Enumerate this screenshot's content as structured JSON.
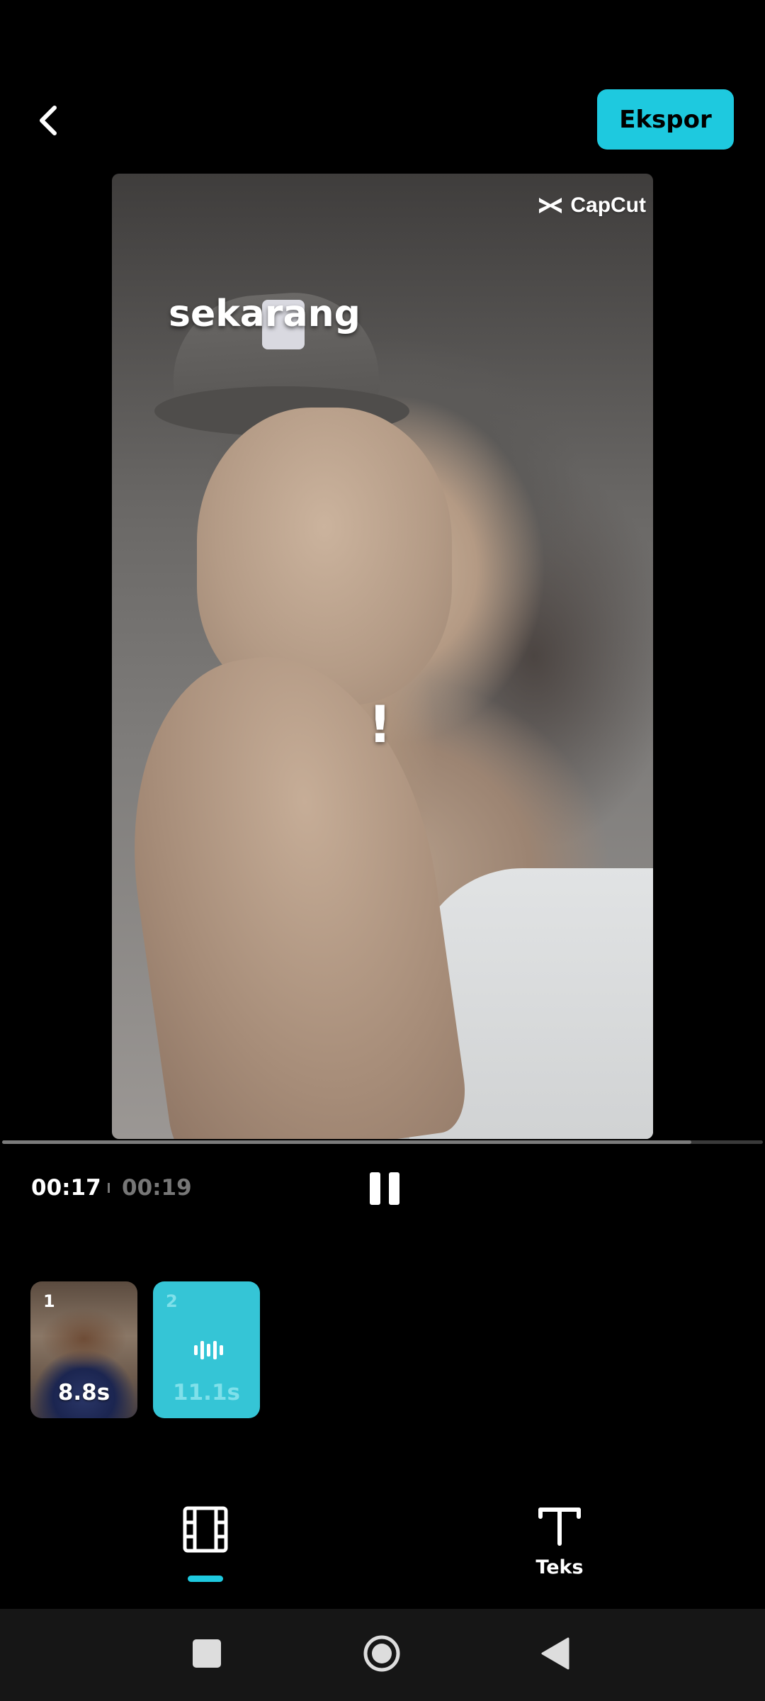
{
  "header": {
    "back_icon": "chevron-left-icon",
    "export_label": "Ekspor",
    "accent_color": "#1ec9df"
  },
  "preview": {
    "watermark": "CapCut",
    "overlay_text": "sekarang",
    "overlay_mark": "!"
  },
  "playback": {
    "current_time": "00:17",
    "total_time": "00:19",
    "progress_fraction": 0.906,
    "pause_icon": "pause-icon"
  },
  "clips": [
    {
      "number": "1",
      "duration": "8.8s"
    },
    {
      "number": "2",
      "duration": "11.1s",
      "icon": "audio-waveform-icon"
    }
  ],
  "tabs": [
    {
      "icon": "film-strip-icon",
      "label": "",
      "active": true
    },
    {
      "icon": "text-icon",
      "label": "Teks",
      "active": false
    }
  ],
  "system_nav": {
    "icons": [
      "recent-apps-icon",
      "home-icon",
      "back-triangle-icon"
    ]
  }
}
